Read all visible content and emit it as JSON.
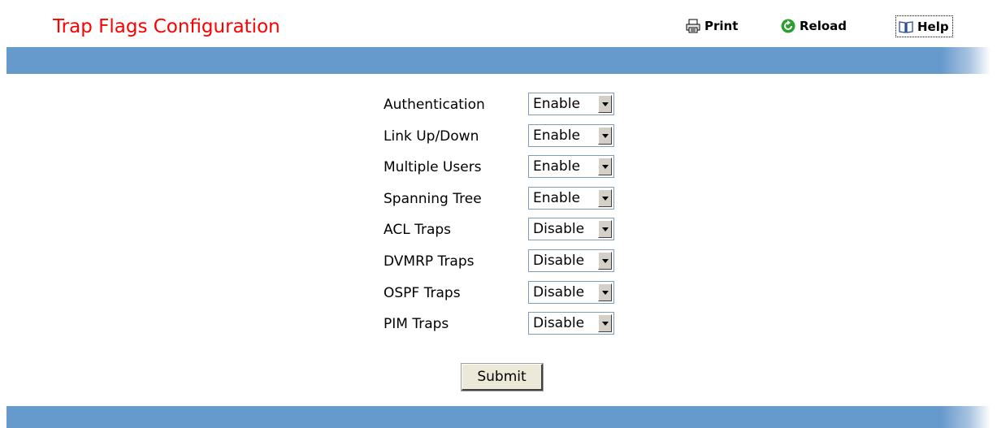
{
  "header": {
    "title": "Trap Flags Configuration",
    "print_label": "Print",
    "reload_label": "Reload",
    "help_label": "Help"
  },
  "form": {
    "fields": [
      {
        "label": "Authentication",
        "value": "Enable"
      },
      {
        "label": "Link Up/Down",
        "value": "Enable"
      },
      {
        "label": "Multiple Users",
        "value": "Enable"
      },
      {
        "label": "Spanning Tree",
        "value": "Enable"
      },
      {
        "label": "ACL Traps",
        "value": "Disable"
      },
      {
        "label": "DVMRP Traps",
        "value": "Disable"
      },
      {
        "label": "OSPF Traps",
        "value": "Disable"
      },
      {
        "label": "PIM Traps",
        "value": "Disable"
      }
    ],
    "submit_label": "Submit"
  },
  "colors": {
    "title": "#ff0000",
    "band": "#6699cc"
  },
  "icons": {
    "print": "printer-icon",
    "reload": "reload-icon",
    "help": "book-icon",
    "dropdown": "chevron-down-icon"
  }
}
